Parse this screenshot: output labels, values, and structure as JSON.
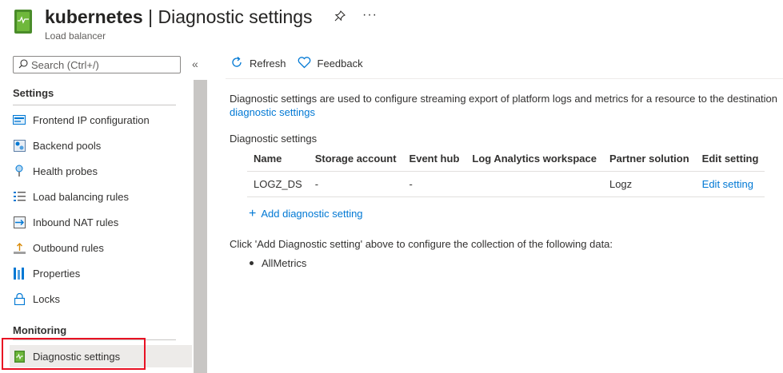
{
  "header": {
    "resource_name": "kubernetes",
    "separator": "|",
    "page_title": "Diagnostic settings",
    "resource_type": "Load balancer",
    "more_label": "···"
  },
  "sidebar": {
    "search_placeholder": "Search (Ctrl+/)",
    "collapse_label": "«",
    "settings_heading": "Settings",
    "settings_items": [
      {
        "label": "Frontend IP configuration",
        "icon": "frontend-ip-icon"
      },
      {
        "label": "Backend pools",
        "icon": "backend-pools-icon"
      },
      {
        "label": "Health probes",
        "icon": "health-probe-icon"
      },
      {
        "label": "Load balancing rules",
        "icon": "rules-list-icon"
      },
      {
        "label": "Inbound NAT rules",
        "icon": "inbound-nat-icon"
      },
      {
        "label": "Outbound rules",
        "icon": "outbound-rules-icon"
      },
      {
        "label": "Properties",
        "icon": "properties-icon"
      },
      {
        "label": "Locks",
        "icon": "lock-icon"
      }
    ],
    "monitoring_heading": "Monitoring",
    "monitoring_items": [
      {
        "label": "Diagnostic settings",
        "icon": "diagnostic-settings-icon",
        "active": true
      }
    ]
  },
  "toolbar": {
    "refresh_label": "Refresh",
    "feedback_label": "Feedback"
  },
  "main": {
    "description": "Diagnostic settings are used to configure streaming export of platform logs and metrics for a resource to the destination",
    "description_link": "diagnostic settings",
    "section_label": "Diagnostic settings",
    "table": {
      "columns": [
        "Name",
        "Storage account",
        "Event hub",
        "Log Analytics workspace",
        "Partner solution",
        "Edit setting"
      ],
      "rows": [
        [
          "LOGZ_DS",
          "-",
          "-",
          "",
          "Logz",
          "Edit setting"
        ]
      ]
    },
    "add_label": "Add diagnostic setting",
    "click_message": "Click 'Add Diagnostic setting' above to configure the collection of the following data:",
    "data_items": [
      "AllMetrics"
    ]
  },
  "colors": {
    "accent": "#0078d4",
    "highlight_border": "#e81123",
    "brand_green": "#6fb83b"
  }
}
